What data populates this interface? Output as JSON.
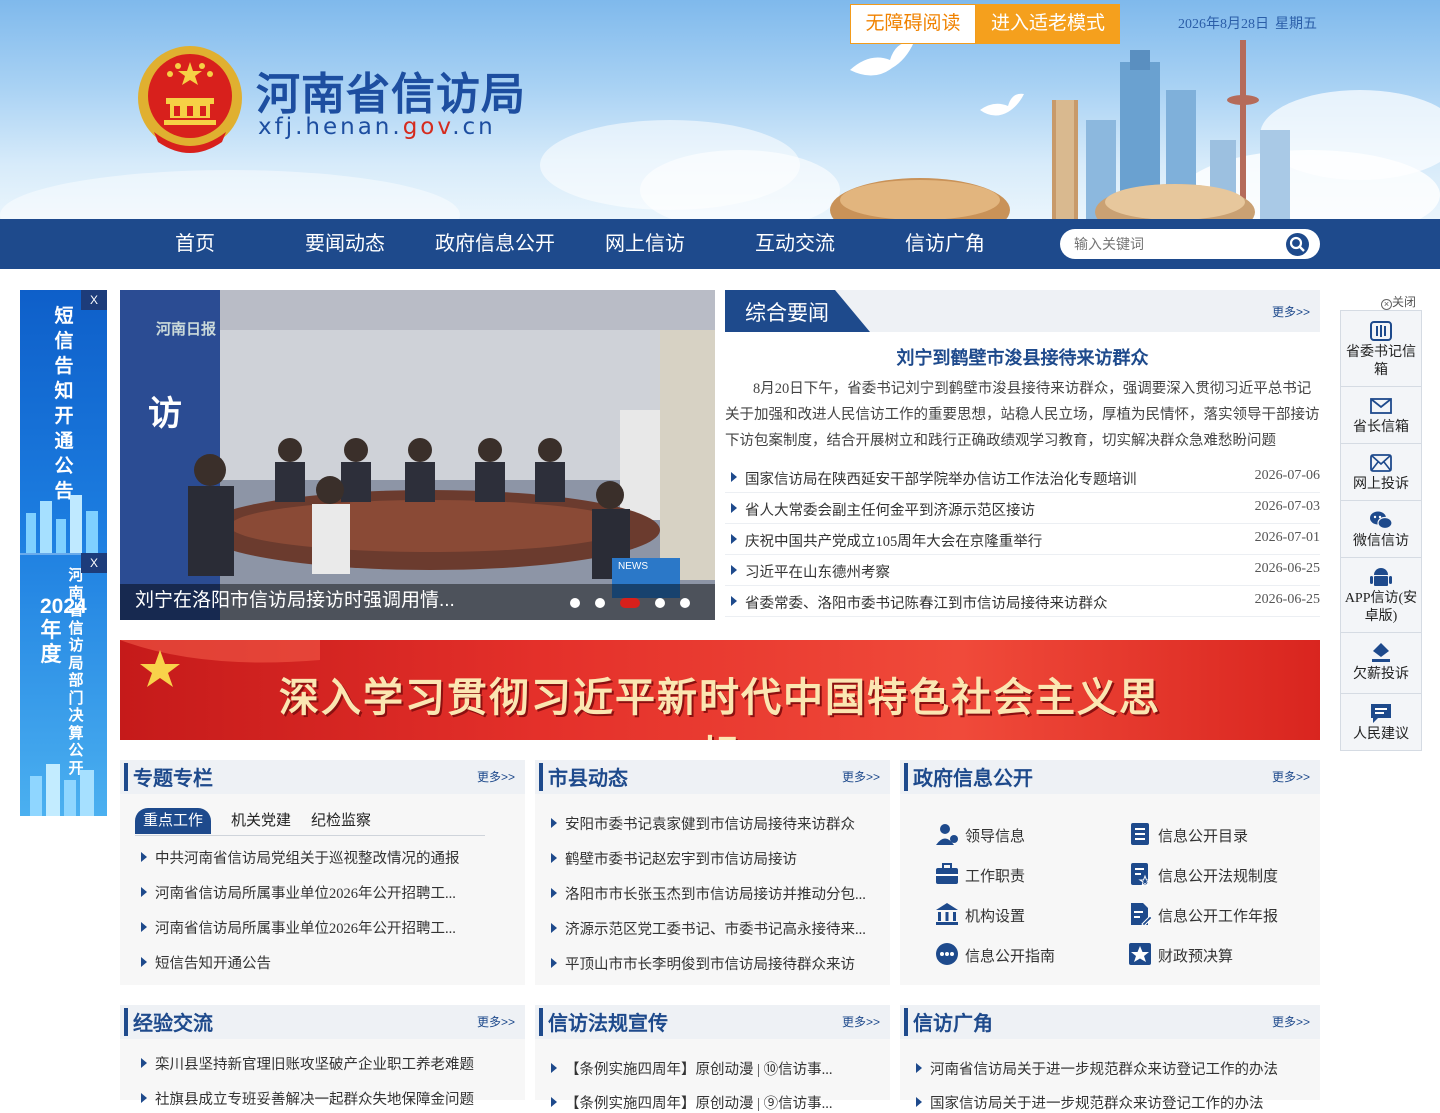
{
  "header": {
    "site_title": "河南省信访局",
    "site_url_a": "xfj.henan.",
    "site_url_b": "gov",
    "site_url_c": ".cn",
    "accessibility_label": "无障碍阅读",
    "elder_mode_label": "进入适老模式",
    "date": "2026年8月28日",
    "weekday": "星期五"
  },
  "nav": {
    "items": [
      "首页",
      "要闻动态",
      "政府信息公开",
      "网上信访",
      "互动交流",
      "信访广角"
    ],
    "search_placeholder": "输入关键词"
  },
  "left_float": {
    "close": "X",
    "notice_text": "短信告知开通公告",
    "budget_text_a": "河南省信访局部门决算公开",
    "budget_text_b": "2024年度"
  },
  "slider": {
    "caption": "刘宁在洛阳市信访局接访时强调用情...",
    "watermark": "河南日报",
    "wall_char": "访",
    "news_badge": "NEWS",
    "slide_count": 5,
    "active_slide": 3
  },
  "news": {
    "tab_title": "综合要闻",
    "more": "更多>>",
    "headline": "刘宁到鹤壁市浚县接待来访群众",
    "summary": "8月20日下午，省委书记刘宁到鹤壁市浚县接待来访群众，强调要深入贯彻习近平总书记关于加强和改进人民信访工作的重要思想，站稳人民立场，厚植为民情怀，落实领导干部接访下访包案制度，结合开展树立和践行正确政绩观学习教育，切实解决群众急难愁盼问题",
    "items": [
      {
        "title": "国家信访局在陕西延安干部学院举办信访工作法治化专题培训",
        "date": "2026-07-06"
      },
      {
        "title": "省人大常委会副主任何金平到济源示范区接访",
        "date": "2026-07-03"
      },
      {
        "title": "庆祝中国共产党成立105周年大会在京隆重举行",
        "date": "2026-07-01"
      },
      {
        "title": "习近平在山东德州考察",
        "date": "2026-06-25"
      },
      {
        "title": "省委常委、洛阳市委书记陈春江到市信访局接待来访群众",
        "date": "2026-06-25"
      }
    ]
  },
  "banner": {
    "text": "深入学习贯彻习近平新时代中国特色社会主义思想"
  },
  "panels": {
    "special": {
      "title": "专题专栏",
      "more": "更多>>",
      "tabs": [
        "重点工作",
        "机关党建",
        "纪检监察"
      ],
      "items": [
        "中共河南省信访局党组关于巡视整改情况的通报",
        "河南省信访局所属事业单位2026年公开招聘工...",
        "河南省信访局所属事业单位2026年公开招聘工...",
        "短信告知开通公告"
      ]
    },
    "city": {
      "title": "市县动态",
      "more": "更多>>",
      "items": [
        "安阳市委书记袁家健到市信访局接待来访群众",
        "鹤壁市委书记赵宏宇到市信访局接访",
        "洛阳市市长张玉杰到市信访局接访并推动分包...",
        "济源示范区党工委书记、市委书记高永接待来...",
        "平顶山市市长李明俊到市信访局接待群众来访"
      ]
    },
    "gov_info": {
      "title": "政府信息公开",
      "more": "更多>>",
      "items": [
        {
          "label": "领导信息",
          "icon": "leader-icon"
        },
        {
          "label": "信息公开目录",
          "icon": "catalog-icon"
        },
        {
          "label": "工作职责",
          "icon": "briefcase-icon"
        },
        {
          "label": "信息公开法规制度",
          "icon": "regulation-icon"
        },
        {
          "label": "机构设置",
          "icon": "institution-icon"
        },
        {
          "label": "信息公开工作年报",
          "icon": "annual-report-icon"
        },
        {
          "label": "信息公开指南",
          "icon": "guide-icon"
        },
        {
          "label": "财政预决算",
          "icon": "finance-icon"
        }
      ]
    },
    "experience": {
      "title": "经验交流",
      "more": "更多>>",
      "items": [
        "栾川县坚持新官理旧账攻坚破产企业职工养老难题",
        "社旗县成立专班妥善解决一起群众失地保障金问题"
      ]
    },
    "law": {
      "title": "信访法规宣传",
      "more": "更多>>",
      "items": [
        "【条例实施四周年】原创动漫 | ⑩信访事...",
        "【条例实施四周年】原创动漫 | ⑨信访事..."
      ]
    },
    "corner": {
      "title": "信访广角",
      "more": "更多>>",
      "items": [
        "河南省信访局关于进一步规范群众来访登记工作的办法",
        "国家信访局关于进一步规范群众来访登记工作的办法"
      ]
    }
  },
  "right_float": {
    "close_label": "关闭",
    "items": [
      {
        "label": "省委书记信箱",
        "icon": "book-icon"
      },
      {
        "label": "省长信箱",
        "icon": "mailbox-icon"
      },
      {
        "label": "网上投诉",
        "icon": "mail-icon"
      },
      {
        "label": "微信信访",
        "icon": "wechat-icon"
      },
      {
        "label": "APP信访(安卓版)",
        "icon": "android-icon"
      },
      {
        "label": "欠薪投诉",
        "icon": "pen-icon"
      },
      {
        "label": "人民建议",
        "icon": "chat-icon"
      }
    ]
  },
  "colors": {
    "primary": "#1e4a8c",
    "accent_orange": "#f5a01d",
    "banner_red": "#e4302a"
  }
}
